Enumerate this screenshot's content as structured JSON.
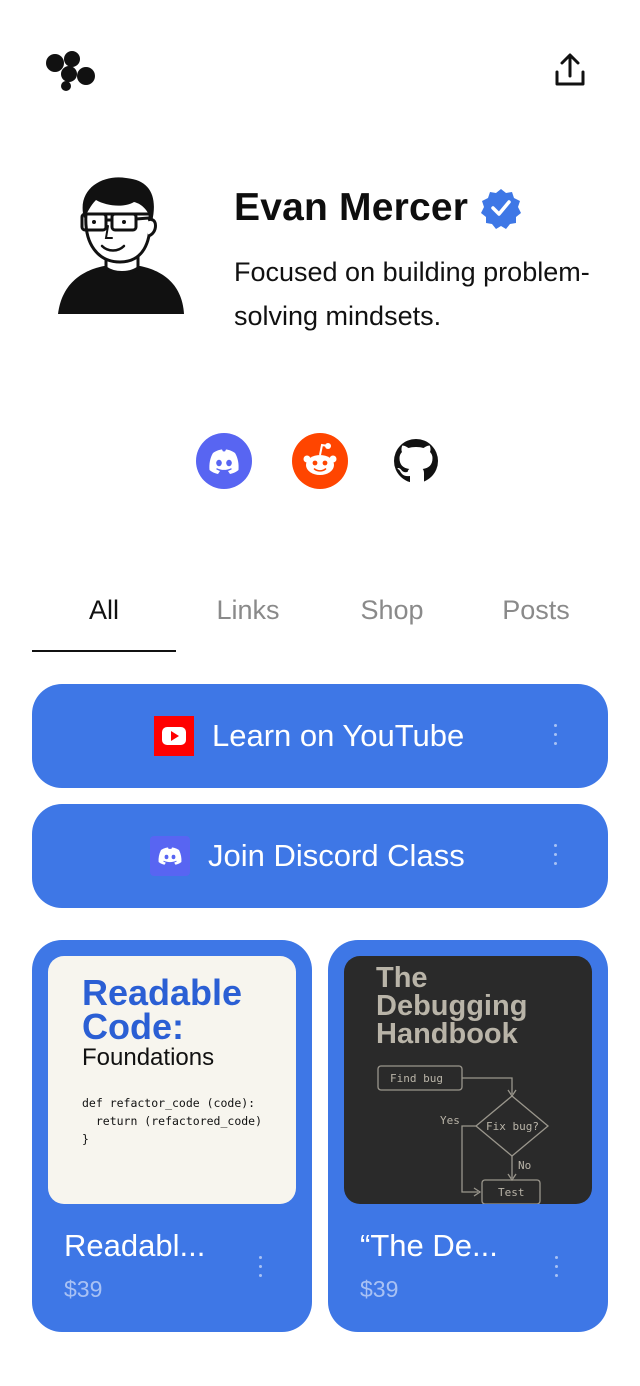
{
  "profile": {
    "name": "Evan Mercer",
    "bio": "Focused on building problem-solving mindsets."
  },
  "socials": [
    {
      "name": "Discord",
      "icon": "discord-icon",
      "color": "#5865f2"
    },
    {
      "name": "Reddit",
      "icon": "reddit-icon",
      "color": "#ff4500"
    },
    {
      "name": "GitHub",
      "icon": "github-icon",
      "color": "#111111"
    }
  ],
  "tabs": [
    {
      "label": "All",
      "active": true
    },
    {
      "label": "Links",
      "active": false
    },
    {
      "label": "Shop",
      "active": false
    },
    {
      "label": "Posts",
      "active": false
    }
  ],
  "links": [
    {
      "label": "Learn on YouTube",
      "icon": "youtube-icon"
    },
    {
      "label": "Join Discord Class",
      "icon": "discord-icon"
    }
  ],
  "products": [
    {
      "title": "Readabl...",
      "price": "$39",
      "cover": {
        "line1": "Readable",
        "line2": "Code:",
        "subtitle": "Foundations",
        "code": "def refactor_code (code):\n  return (refactored_code)\n}"
      }
    },
    {
      "title": "“The De...",
      "price": "$39",
      "cover": {
        "line1": "The",
        "line2": "Debugging",
        "line3": "Handbook",
        "step1": "Find bug",
        "decision": "Fix bug?",
        "yes": "Yes",
        "no": "No",
        "step2": "Test"
      }
    }
  ],
  "colors": {
    "accent": "#3e77e6",
    "verified": "#3e77e6"
  }
}
